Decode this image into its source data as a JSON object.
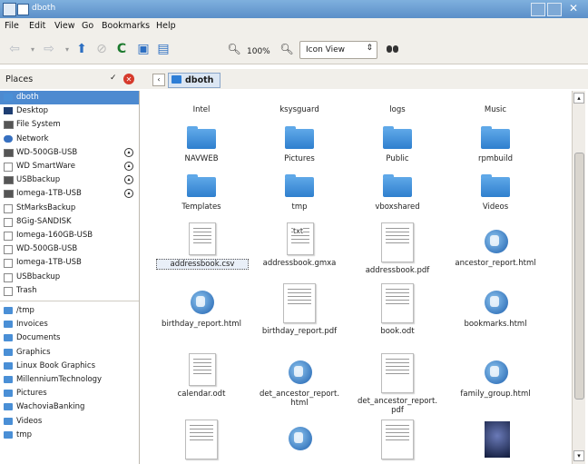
{
  "window": {
    "title": "dboth"
  },
  "menu": [
    "File",
    "Edit",
    "View",
    "Go",
    "Bookmarks",
    "Help"
  ],
  "toolbar": {
    "zoom": "100%",
    "view_mode": "Icon View"
  },
  "places": {
    "label": "Places"
  },
  "path": {
    "current": "dboth"
  },
  "sidebar": {
    "devices": [
      {
        "label": "dboth",
        "icon": "home-folder-icon",
        "selected": true
      },
      {
        "label": "Desktop",
        "icon": "desktop-icon"
      },
      {
        "label": "File System",
        "icon": "drive-icon"
      },
      {
        "label": "Network",
        "icon": "network-icon"
      },
      {
        "label": "WD-500GB-USB",
        "icon": "drive-icon",
        "eject": true
      },
      {
        "label": "WD SmartWare",
        "icon": "volume-icon",
        "eject": true
      },
      {
        "label": "USBbackup",
        "icon": "drive-icon",
        "eject": true
      },
      {
        "label": "Iomega-1TB-USB",
        "icon": "drive-icon",
        "eject": true
      },
      {
        "label": "StMarksBackup",
        "icon": "volume-icon"
      },
      {
        "label": "8Gig-SANDISK",
        "icon": "volume-icon"
      },
      {
        "label": "Iomega-160GB-USB",
        "icon": "volume-icon"
      },
      {
        "label": "WD-500GB-USB",
        "icon": "volume-icon"
      },
      {
        "label": "Iomega-1TB-USB",
        "icon": "volume-icon"
      },
      {
        "label": "USBbackup",
        "icon": "volume-icon"
      },
      {
        "label": "Trash",
        "icon": "trash-icon"
      }
    ],
    "bookmarks": [
      {
        "label": "/tmp"
      },
      {
        "label": "Invoices"
      },
      {
        "label": "Documents"
      },
      {
        "label": "Graphics"
      },
      {
        "label": "Linux Book Graphics"
      },
      {
        "label": "MillenniumTechnology"
      },
      {
        "label": "Pictures"
      },
      {
        "label": "WachoviaBanking"
      },
      {
        "label": "Videos"
      },
      {
        "label": "tmp"
      }
    ]
  },
  "files": [
    {
      "label": "Intel",
      "type": "folder-label-only"
    },
    {
      "label": "ksysguard",
      "type": "folder-label-only"
    },
    {
      "label": "logs",
      "type": "folder-label-only"
    },
    {
      "label": "Music",
      "type": "folder-label-only"
    },
    {
      "label": "NAVWEB",
      "type": "folder"
    },
    {
      "label": "Pictures",
      "type": "folder"
    },
    {
      "label": "Public",
      "type": "folder"
    },
    {
      "label": "rpmbuild",
      "type": "folder"
    },
    {
      "label": "Templates",
      "type": "folder"
    },
    {
      "label": "tmp",
      "type": "folder"
    },
    {
      "label": "vboxshared",
      "type": "folder"
    },
    {
      "label": "Videos",
      "type": "folder"
    },
    {
      "label": "addressbook.csv",
      "type": "doc",
      "selected": true
    },
    {
      "label": "addressbook.gmxa",
      "type": "doc",
      "badge": "txt"
    },
    {
      "label": "addressbook.pdf",
      "type": "doc-wide"
    },
    {
      "label": "ancestor_report.html",
      "type": "globe"
    },
    {
      "label": "birthday_report.html",
      "type": "globe"
    },
    {
      "label": "birthday_report.pdf",
      "type": "doc-wide"
    },
    {
      "label": "book.odt",
      "type": "doc-wide"
    },
    {
      "label": "bookmarks.html",
      "type": "globe"
    },
    {
      "label": "calendar.odt",
      "type": "doc"
    },
    {
      "label": "det_ancestor_report.\nhtml",
      "type": "globe"
    },
    {
      "label": "det_ancestor_report.\npdf",
      "type": "doc-wide"
    },
    {
      "label": "family_group.html",
      "type": "globe"
    },
    {
      "label": "",
      "type": "doc-wide"
    },
    {
      "label": "",
      "type": "globe"
    },
    {
      "label": "",
      "type": "doc-wide"
    },
    {
      "label": "",
      "type": "image"
    }
  ]
}
